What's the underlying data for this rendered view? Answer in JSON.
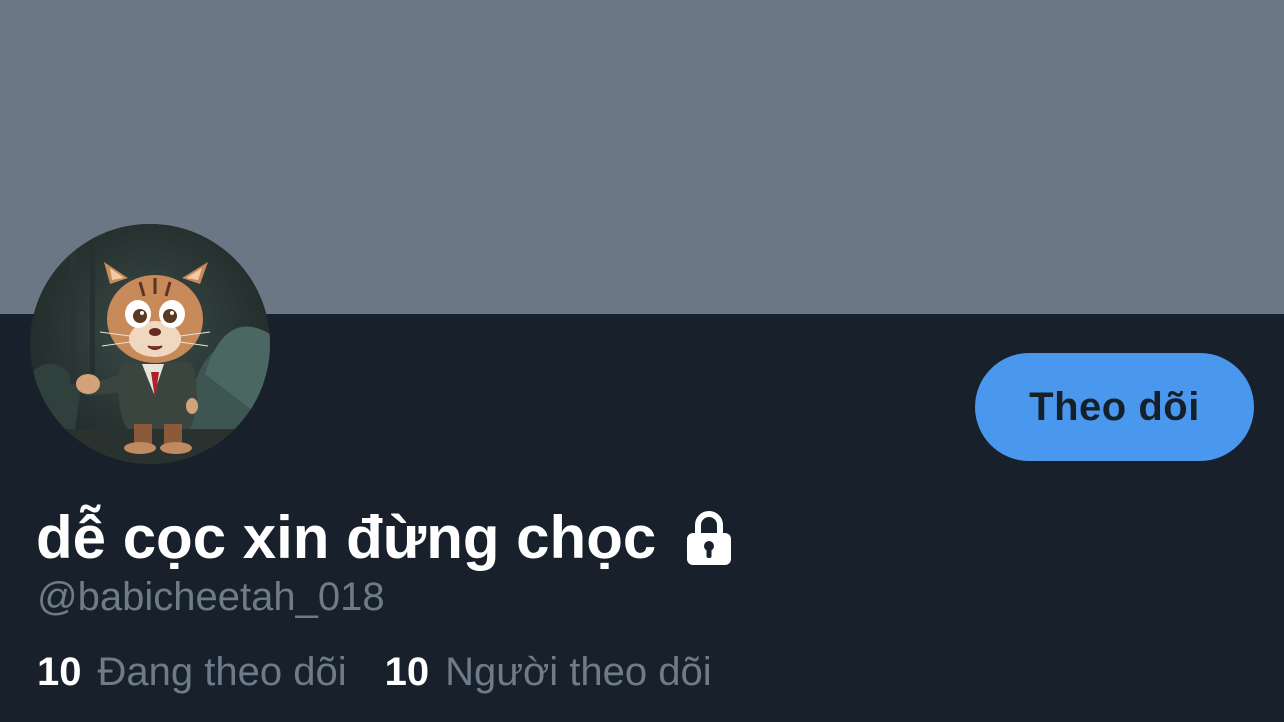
{
  "profile": {
    "display_name": "dễ cọc xin đừng chọc",
    "handle": "@babicheetah_018",
    "locked_icon": "lock-icon",
    "avatar_icon": "avatar-image"
  },
  "actions": {
    "follow_label": "Theo dõi"
  },
  "stats": {
    "following_count": "10",
    "following_label": "Đang theo dõi",
    "followers_count": "10",
    "followers_label": "Người theo dõi"
  },
  "colors": {
    "banner": "#6b7784",
    "background": "#17202b",
    "accent": "#4a97ee",
    "muted_text": "#6e7b88",
    "primary_text": "#ffffff"
  }
}
